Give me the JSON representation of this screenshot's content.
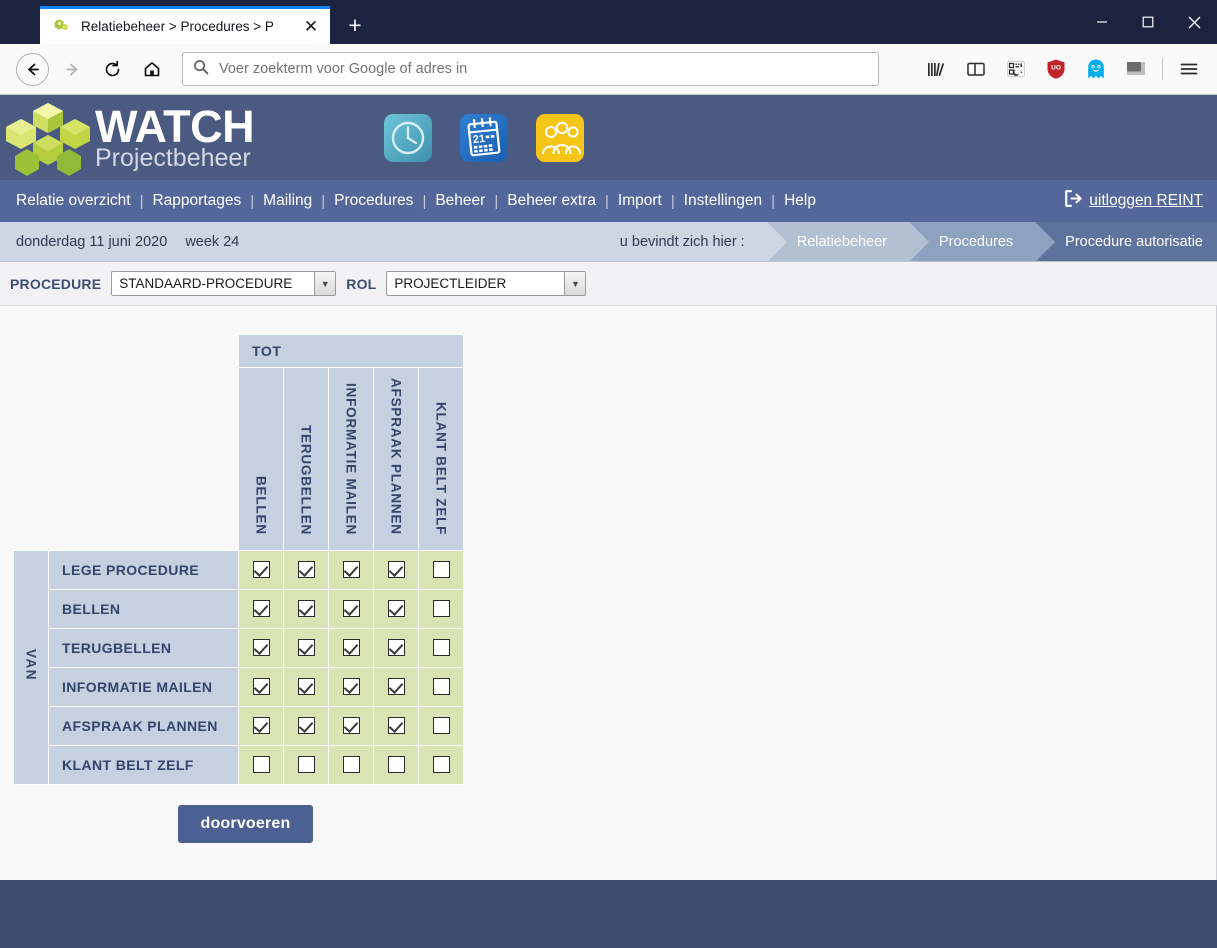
{
  "browser": {
    "tab": {
      "title": "Relatiebeheer > Procedures > P",
      "favicon_icon": "puzzle-favicon",
      "close_icon": "close-icon"
    },
    "new_tab_icon": "plus-icon",
    "window_controls": [
      {
        "name": "minimize",
        "icon": "minimize-icon",
        "glyph": "─"
      },
      {
        "name": "maximize",
        "icon": "maximize-icon",
        "glyph": "☐"
      },
      {
        "name": "close",
        "icon": "window-close-icon",
        "glyph": "✕"
      }
    ],
    "nav": {
      "back_icon": "back-arrow-icon",
      "forward_icon": "forward-arrow-icon",
      "reload_icon": "reload-icon",
      "home_icon": "home-icon"
    },
    "address_bar": {
      "search_icon": "search-icon",
      "placeholder": "Voer zoekterm voor Google of adres in",
      "value": ""
    },
    "toolbar_icons": [
      {
        "name": "library-icon",
        "label": "Bibliotheek"
      },
      {
        "name": "sidebar-icon",
        "label": "Zijbalken"
      },
      {
        "name": "qr-reader-icon",
        "label": "Lezerweergave"
      },
      {
        "name": "ublock-origin-icon",
        "label": "uBlock Origin"
      },
      {
        "name": "ghostery-icon",
        "label": "Ghostery"
      },
      {
        "name": "extension-square-icon",
        "label": "Extensie"
      },
      {
        "name": "hamburger-menu-icon",
        "label": "Menu openen"
      }
    ]
  },
  "app": {
    "logo": {
      "mark_icon": "watch-cube-logo",
      "title": "WATCH",
      "subtitle": "Projectbeheer"
    },
    "header_icons": [
      {
        "name": "clock-icon",
        "label": "Tijdregistratie"
      },
      {
        "name": "calendar-icon",
        "label": "Agenda",
        "day": "21"
      },
      {
        "name": "people-icon",
        "label": "Relaties"
      }
    ],
    "menu": {
      "items": [
        "Relatie overzicht",
        "Rapportages",
        "Mailing",
        "Procedures",
        "Beheer",
        "Beheer extra",
        "Import",
        "Instellingen",
        "Help"
      ],
      "separator": "|",
      "logout": {
        "icon": "logout-icon",
        "label": "uitloggen REINT"
      }
    },
    "statusbar": {
      "date": "donderdag 11 juni 2020",
      "week": "week 24",
      "here_label": "u bevindt zich hier :",
      "breadcrumbs": [
        "Relatiebeheer",
        "Procedures",
        "Procedure autorisatie"
      ]
    },
    "filters": [
      {
        "label": "PROCEDURE",
        "value": "STANDAARD-PROCEDURE",
        "name": "procedure-select"
      },
      {
        "label": "ROL",
        "value": "PROJECTLEIDER",
        "name": "rol-select"
      }
    ],
    "matrix": {
      "col_group_label": "TOT",
      "row_group_label": "VAN",
      "columns": [
        "BELLEN",
        "TERUGBELLEN",
        "INFORMATIE MAILEN",
        "AFSPRAAK PLANNEN",
        "KLANT BELT ZELF"
      ],
      "rows": [
        {
          "label": "LEGE PROCEDURE",
          "checks": [
            true,
            true,
            true,
            true,
            false
          ]
        },
        {
          "label": "BELLEN",
          "checks": [
            true,
            true,
            true,
            true,
            false
          ]
        },
        {
          "label": "TERUGBELLEN",
          "checks": [
            true,
            true,
            true,
            true,
            false
          ]
        },
        {
          "label": "INFORMATIE MAILEN",
          "checks": [
            true,
            true,
            true,
            true,
            false
          ]
        },
        {
          "label": "AFSPRAAK PLANNEN",
          "checks": [
            true,
            true,
            true,
            true,
            false
          ]
        },
        {
          "label": "KLANT BELT ZELF",
          "checks": [
            false,
            false,
            false,
            false,
            false
          ]
        }
      ]
    },
    "submit_label": "doorvoeren"
  },
  "colors": {
    "brand_header": "#4a5a80",
    "menu_bar": "#54679a",
    "status_bar": "#cdd6e2",
    "table_head": "#c5d0e0",
    "cell_green": "#d9e3b4",
    "button": "#4d6094",
    "footer": "#3f4e70",
    "heading_text": "#34456b"
  }
}
